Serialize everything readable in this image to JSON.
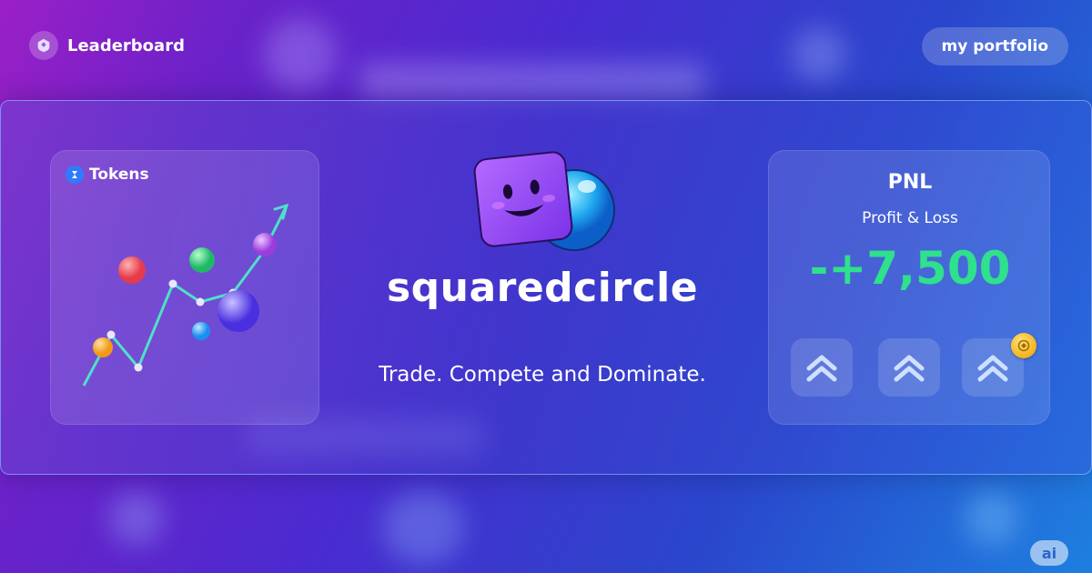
{
  "header": {
    "leaderboard_label": "Leaderboard",
    "leaderboard_icon": "trophy-icon",
    "portfolio_label": "my portfolio"
  },
  "tokens_panel": {
    "label": "Tokens",
    "icon": "token-icon"
  },
  "hero": {
    "brand": "squaredcircle",
    "tagline": "Trade. Compete and Dominate."
  },
  "pnl_panel": {
    "title": "PNL",
    "subtitle": "Profit & Loss",
    "value": "-+7,500",
    "value_color": "#2fe08c",
    "buttons": [
      "chevrons-up-icon",
      "chevrons-up-icon",
      "chevrons-up-icon"
    ],
    "badge_icon": "coin-icon"
  },
  "footer": {
    "ai_label": "ai"
  },
  "colors": {
    "accent_green": "#2fe08c",
    "line_teal": "#4fe0c8",
    "card_border": "#8cbeff"
  }
}
